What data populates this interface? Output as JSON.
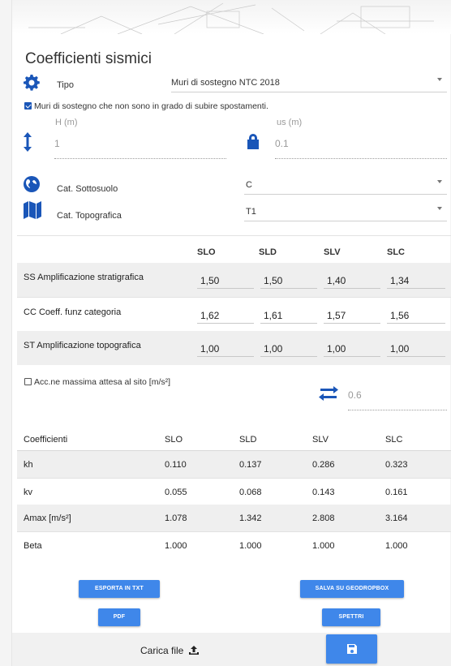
{
  "title": "Coefficienti sismici",
  "tipo": {
    "label": "Tipo",
    "value": "Muri di sostegno NTC 2018"
  },
  "check_spostamenti": {
    "label": "Muri di sostegno che non sono in grado di subire spostamenti.",
    "checked": true
  },
  "h": {
    "label": "H (m)",
    "value": "1"
  },
  "us": {
    "label": "us (m)",
    "value": "0.1"
  },
  "sottosuolo": {
    "label": "Cat. Sottosuolo",
    "value": "C"
  },
  "topografica": {
    "label": "Cat. Topografica",
    "value": "T1"
  },
  "grid": {
    "headers": [
      "SLO",
      "SLD",
      "SLV",
      "SLC"
    ],
    "rows": [
      {
        "label": "SS Amplificazione stratigrafica",
        "values": [
          "1,50",
          "1,50",
          "1,40",
          "1,34"
        ]
      },
      {
        "label": "CC Coeff. funz categoria",
        "values": [
          "1,62",
          "1,61",
          "1,57",
          "1,56"
        ]
      },
      {
        "label": "ST Amplificazione topografica",
        "values": [
          "1,00",
          "1,00",
          "1,00",
          "1,00"
        ]
      }
    ]
  },
  "acc": {
    "label": "Acc.ne massima attesa al sito [m/s²]",
    "checked": false,
    "value": "0.6"
  },
  "coeff_table": {
    "headers": [
      "Coefficienti",
      "SLO",
      "SLD",
      "SLV",
      "SLC"
    ],
    "rows": [
      [
        "kh",
        "0.110",
        "0.137",
        "0.286",
        "0.323"
      ],
      [
        "kv",
        "0.055",
        "0.068",
        "0.143",
        "0.161"
      ],
      [
        "Amax [m/s²]",
        "1.078",
        "1.342",
        "2.808",
        "3.164"
      ],
      [
        "Beta",
        "1.000",
        "1.000",
        "1.000",
        "1.000"
      ]
    ]
  },
  "buttons": {
    "export_txt": "ESPORTA IN TXT",
    "pdf": "PDF",
    "save_geodropbox": "SALVA SU GEODROPBOX",
    "spettri": "SPETTRI",
    "carica_file": "Carica file"
  },
  "colors": {
    "accent": "#1a56b8",
    "button": "#3f87ea"
  }
}
